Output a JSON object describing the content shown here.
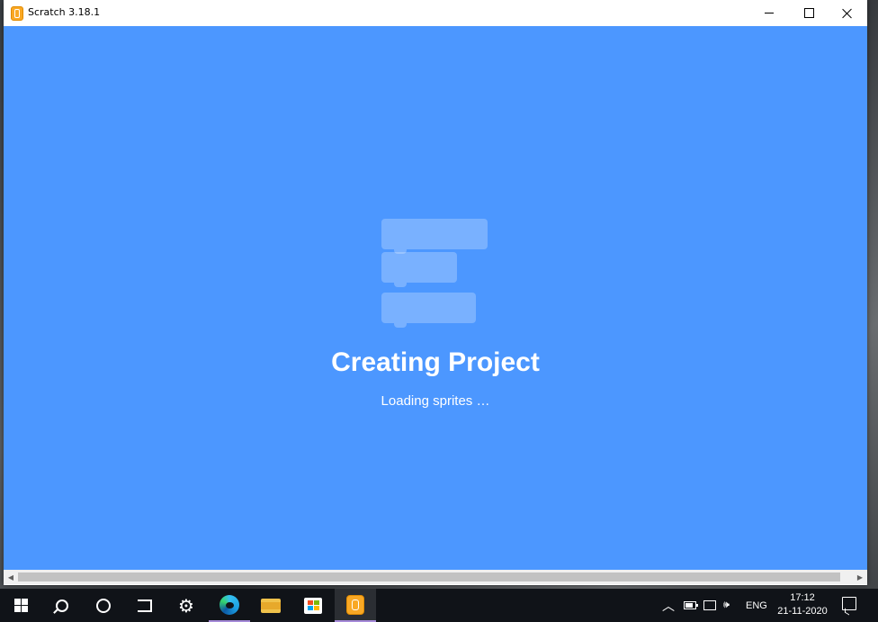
{
  "window": {
    "title": "Scratch 3.18.1",
    "buttons": {
      "minimize": "minimize",
      "maximize": "maximize",
      "close": "close"
    }
  },
  "loading": {
    "title": "Creating Project",
    "subtitle": "Loading sprites …"
  },
  "colors": {
    "content_background": "#4c97ff",
    "taskbar_background": "#101318",
    "scratch_orange": "#f9a825"
  },
  "taskbar": {
    "items": [
      {
        "name": "start-button",
        "icon": "windows-logo-icon"
      },
      {
        "name": "search-button",
        "icon": "search-icon"
      },
      {
        "name": "cortana-button",
        "icon": "cortana-circle-icon"
      },
      {
        "name": "task-view-button",
        "icon": "task-view-icon"
      },
      {
        "name": "settings-app",
        "icon": "gear-icon"
      },
      {
        "name": "edge-app",
        "icon": "edge-icon"
      },
      {
        "name": "file-explorer-app",
        "icon": "folder-icon"
      },
      {
        "name": "store-app",
        "icon": "store-bag-icon"
      },
      {
        "name": "scratch-app",
        "icon": "scratch-icon"
      }
    ],
    "tray": {
      "language": "ENG",
      "time": "17:12",
      "date": "21-11-2020"
    }
  }
}
